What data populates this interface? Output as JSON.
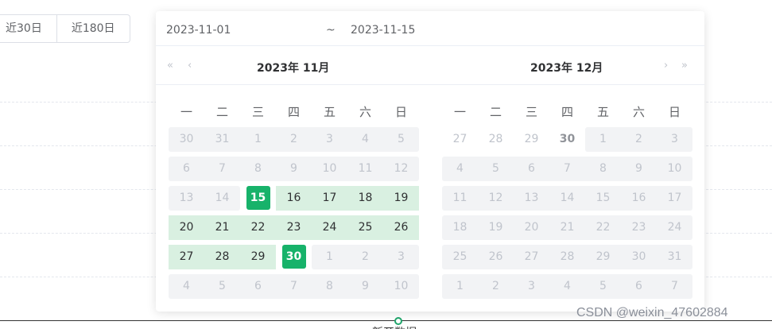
{
  "quick_buttons": [
    "近30日",
    "近180日"
  ],
  "range": {
    "start": "2023-11-01",
    "separator": "~",
    "end": "2023-11-15"
  },
  "left_month": {
    "title": "2023年 11月",
    "nav_prev_year": "«",
    "nav_prev_month": "‹",
    "weekdays": [
      "一",
      "二",
      "三",
      "四",
      "五",
      "六",
      "日"
    ],
    "rows": [
      [
        "30",
        "31",
        "1",
        "2",
        "3",
        "4",
        "5"
      ],
      [
        "6",
        "7",
        "8",
        "9",
        "10",
        "11",
        "12"
      ],
      [
        "13",
        "14",
        "15",
        "16",
        "17",
        "18",
        "19"
      ],
      [
        "20",
        "21",
        "22",
        "23",
        "24",
        "25",
        "26"
      ],
      [
        "27",
        "28",
        "29",
        "30",
        "1",
        "2",
        "3"
      ],
      [
        "4",
        "5",
        "6",
        "7",
        "8",
        "9",
        "10"
      ]
    ]
  },
  "right_month": {
    "title": "2023年 12月",
    "nav_next_month": "›",
    "nav_next_year": "»",
    "weekdays": [
      "一",
      "二",
      "三",
      "四",
      "五",
      "六",
      "日"
    ],
    "rows": [
      [
        "27",
        "28",
        "29",
        "30",
        "1",
        "2",
        "3"
      ],
      [
        "4",
        "5",
        "6",
        "7",
        "8",
        "9",
        "10"
      ],
      [
        "11",
        "12",
        "13",
        "14",
        "15",
        "16",
        "17"
      ],
      [
        "18",
        "19",
        "20",
        "21",
        "22",
        "23",
        "24"
      ],
      [
        "25",
        "26",
        "27",
        "28",
        "29",
        "30",
        "31"
      ],
      [
        "1",
        "2",
        "3",
        "4",
        "5",
        "6",
        "7"
      ]
    ]
  },
  "watermark": "CSDN @weixin_47602884",
  "axis_label": "新开数据",
  "colors": {
    "accent": "#17b26a",
    "range_bg": "#d9f0e1",
    "disabled_bg": "#f2f3f5"
  }
}
